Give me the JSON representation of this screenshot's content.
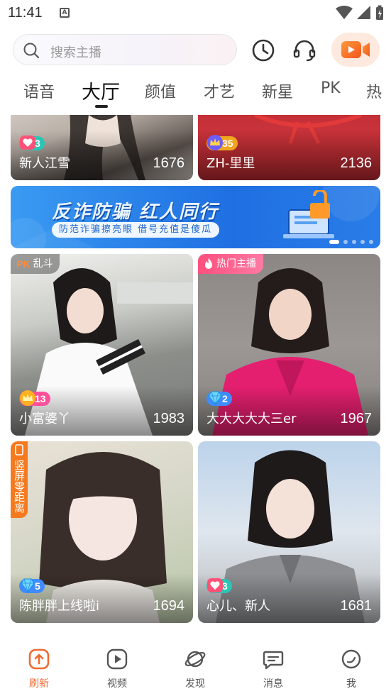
{
  "status_bar": {
    "time": "11:41",
    "notif": "A"
  },
  "search": {
    "placeholder": "搜索主播"
  },
  "tabs": [
    {
      "label": "语音"
    },
    {
      "label": "大厅"
    },
    {
      "label": "颜值"
    },
    {
      "label": "才艺"
    },
    {
      "label": "新星"
    },
    {
      "label": "PK"
    },
    {
      "label": "热"
    }
  ],
  "active_tab": "大厅",
  "cards": [
    {
      "name": "新人江雪",
      "count": "1676",
      "level": "3",
      "level_icon": "heart-icon"
    },
    {
      "name": "ZH-里里",
      "count": "2136",
      "level": "35",
      "level_icon": "crown-icon"
    },
    {
      "name": "小富婆丫",
      "count": "1983",
      "level": "13",
      "level_icon": "crown-icon",
      "tag": "乱斗",
      "tag_prefix": "PK"
    },
    {
      "name": "大大大大大三er",
      "count": "1967",
      "level": "2",
      "level_icon": "diamond-icon",
      "tag": "热门主播"
    },
    {
      "name": "陈胖胖上线啦i",
      "count": "1694",
      "level": "5",
      "level_icon": "diamond-icon",
      "tag": "竖屏零距离"
    },
    {
      "name": "心儿、新人",
      "count": "1681",
      "level": "3",
      "level_icon": "heart-icon"
    }
  ],
  "banner": {
    "title": "反诈防骗  红人同行",
    "subtitle": "防范诈骗擦亮眼  借号充值是傻瓜"
  },
  "bottom_nav": [
    {
      "label": "刷新"
    },
    {
      "label": "视频"
    },
    {
      "label": "发现"
    },
    {
      "label": "消息"
    },
    {
      "label": "我"
    }
  ],
  "colors": {
    "accent": "#f06a34",
    "hot_tag": "#ff5a8a",
    "vertical_tag": "#f57a1f",
    "banner_blue": "#1f6fe2"
  }
}
